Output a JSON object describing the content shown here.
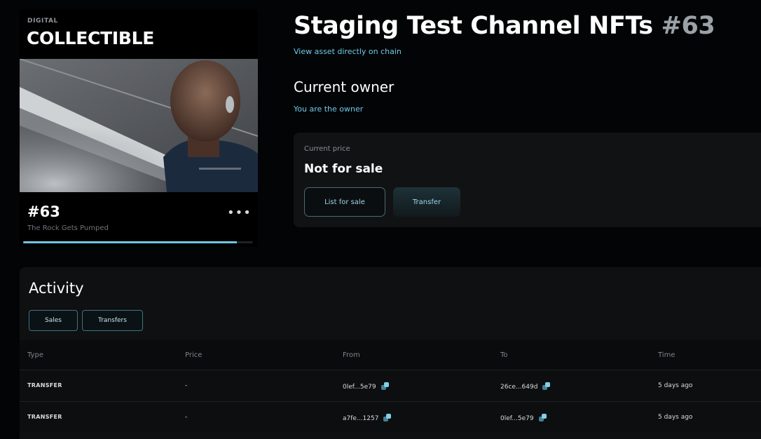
{
  "card": {
    "kicker": "DIGITAL",
    "heading": "COLLECTIBLE",
    "number": "#63",
    "subtitle": "The Rock Gets Pumped",
    "more_label": "•••",
    "progress": 0.93
  },
  "header": {
    "title": "Staging Test Channel NFTs",
    "title_number": "#63",
    "chain_link": "View asset directly on chain"
  },
  "owner": {
    "heading": "Current owner",
    "status": "You are the owner"
  },
  "price": {
    "label": "Current price",
    "value": "Not for sale",
    "list_button": "List for sale",
    "transfer_button": "Transfer"
  },
  "activity": {
    "title": "Activity",
    "filters": [
      "Sales",
      "Transfers"
    ],
    "columns": [
      "Type",
      "Price",
      "From",
      "To",
      "Time"
    ],
    "rows": [
      {
        "type": "TRANSFER",
        "price": "-",
        "from": "0lef...5e79",
        "to": "26ce...649d",
        "time": "5 days ago"
      },
      {
        "type": "TRANSFER",
        "price": "-",
        "from": "a7fe...1257",
        "to": "0lef...5e79",
        "time": "5 days ago"
      }
    ]
  },
  "colors": {
    "accent": "#6fc9e8",
    "background": "#030405",
    "panel": "#111213"
  },
  "icons": {
    "copy": "copy-icon",
    "more": "more-dots-icon"
  }
}
